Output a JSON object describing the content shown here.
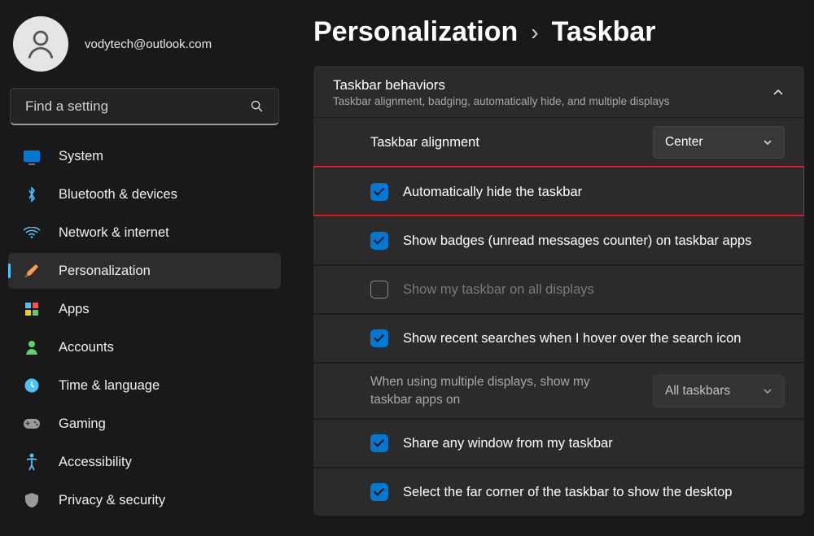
{
  "user": {
    "email": "vodytech@outlook.com"
  },
  "search": {
    "placeholder": "Find a setting"
  },
  "nav": [
    {
      "id": "system",
      "label": "System"
    },
    {
      "id": "bluetooth",
      "label": "Bluetooth & devices"
    },
    {
      "id": "network",
      "label": "Network & internet"
    },
    {
      "id": "personalization",
      "label": "Personalization",
      "active": true
    },
    {
      "id": "apps",
      "label": "Apps"
    },
    {
      "id": "accounts",
      "label": "Accounts"
    },
    {
      "id": "time",
      "label": "Time & language"
    },
    {
      "id": "gaming",
      "label": "Gaming"
    },
    {
      "id": "accessibility",
      "label": "Accessibility"
    },
    {
      "id": "privacy",
      "label": "Privacy & security"
    }
  ],
  "breadcrumb": {
    "parent": "Personalization",
    "current": "Taskbar"
  },
  "panel": {
    "title": "Taskbar behaviors",
    "subtitle": "Taskbar alignment, badging, automatically hide, and multiple displays"
  },
  "alignment": {
    "label": "Taskbar alignment",
    "value": "Center"
  },
  "options": {
    "autoHide": {
      "label": "Automatically hide the taskbar",
      "checked": true,
      "highlight": true
    },
    "badges": {
      "label": "Show badges (unread messages counter) on taskbar apps",
      "checked": true
    },
    "allDisplays": {
      "label": "Show my taskbar on all displays",
      "checked": false,
      "disabled": true
    },
    "recentSearches": {
      "label": "Show recent searches when I hover over the search icon",
      "checked": true
    },
    "multiDisplays": {
      "label": "When using multiple displays, show my taskbar apps on",
      "value": "All taskbars",
      "disabled": true
    },
    "shareWindow": {
      "label": "Share any window from my taskbar",
      "checked": true
    },
    "farCorner": {
      "label": "Select the far corner of the taskbar to show the desktop",
      "checked": true
    }
  }
}
